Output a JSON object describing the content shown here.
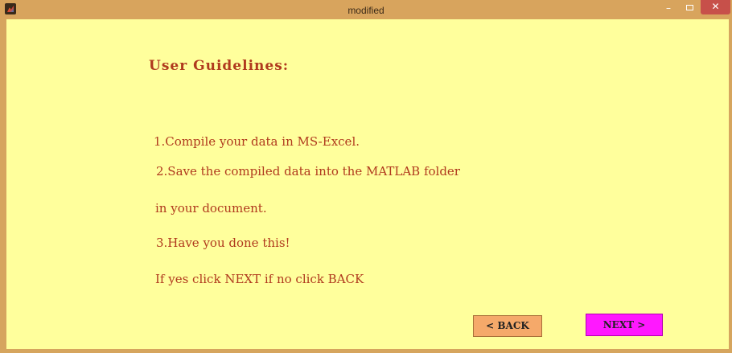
{
  "window": {
    "title": "modified",
    "minimize_glyph": "–",
    "close_glyph": "✕"
  },
  "content": {
    "heading": "User  Guidelines:",
    "lines": [
      "1.Compile your data in MS-Excel.",
      "2.Save the compiled data into the MATLAB folder",
      "in your document.",
      "3.Have you done this!",
      "If yes click NEXT if no click BACK"
    ]
  },
  "buttons": {
    "back_label": "< BACK",
    "next_label": "NEXT >"
  },
  "colors": {
    "titlebar": "#d8a45d",
    "background": "#ffff9c",
    "text": "#b03a1e",
    "back_button": "#f5a96a",
    "next_button": "#ff18ff",
    "close_button": "#c7504a"
  },
  "icons": {
    "app": "matlab-icon",
    "minimize": "minimize-icon",
    "maximize": "maximize-icon",
    "close": "close-icon"
  }
}
